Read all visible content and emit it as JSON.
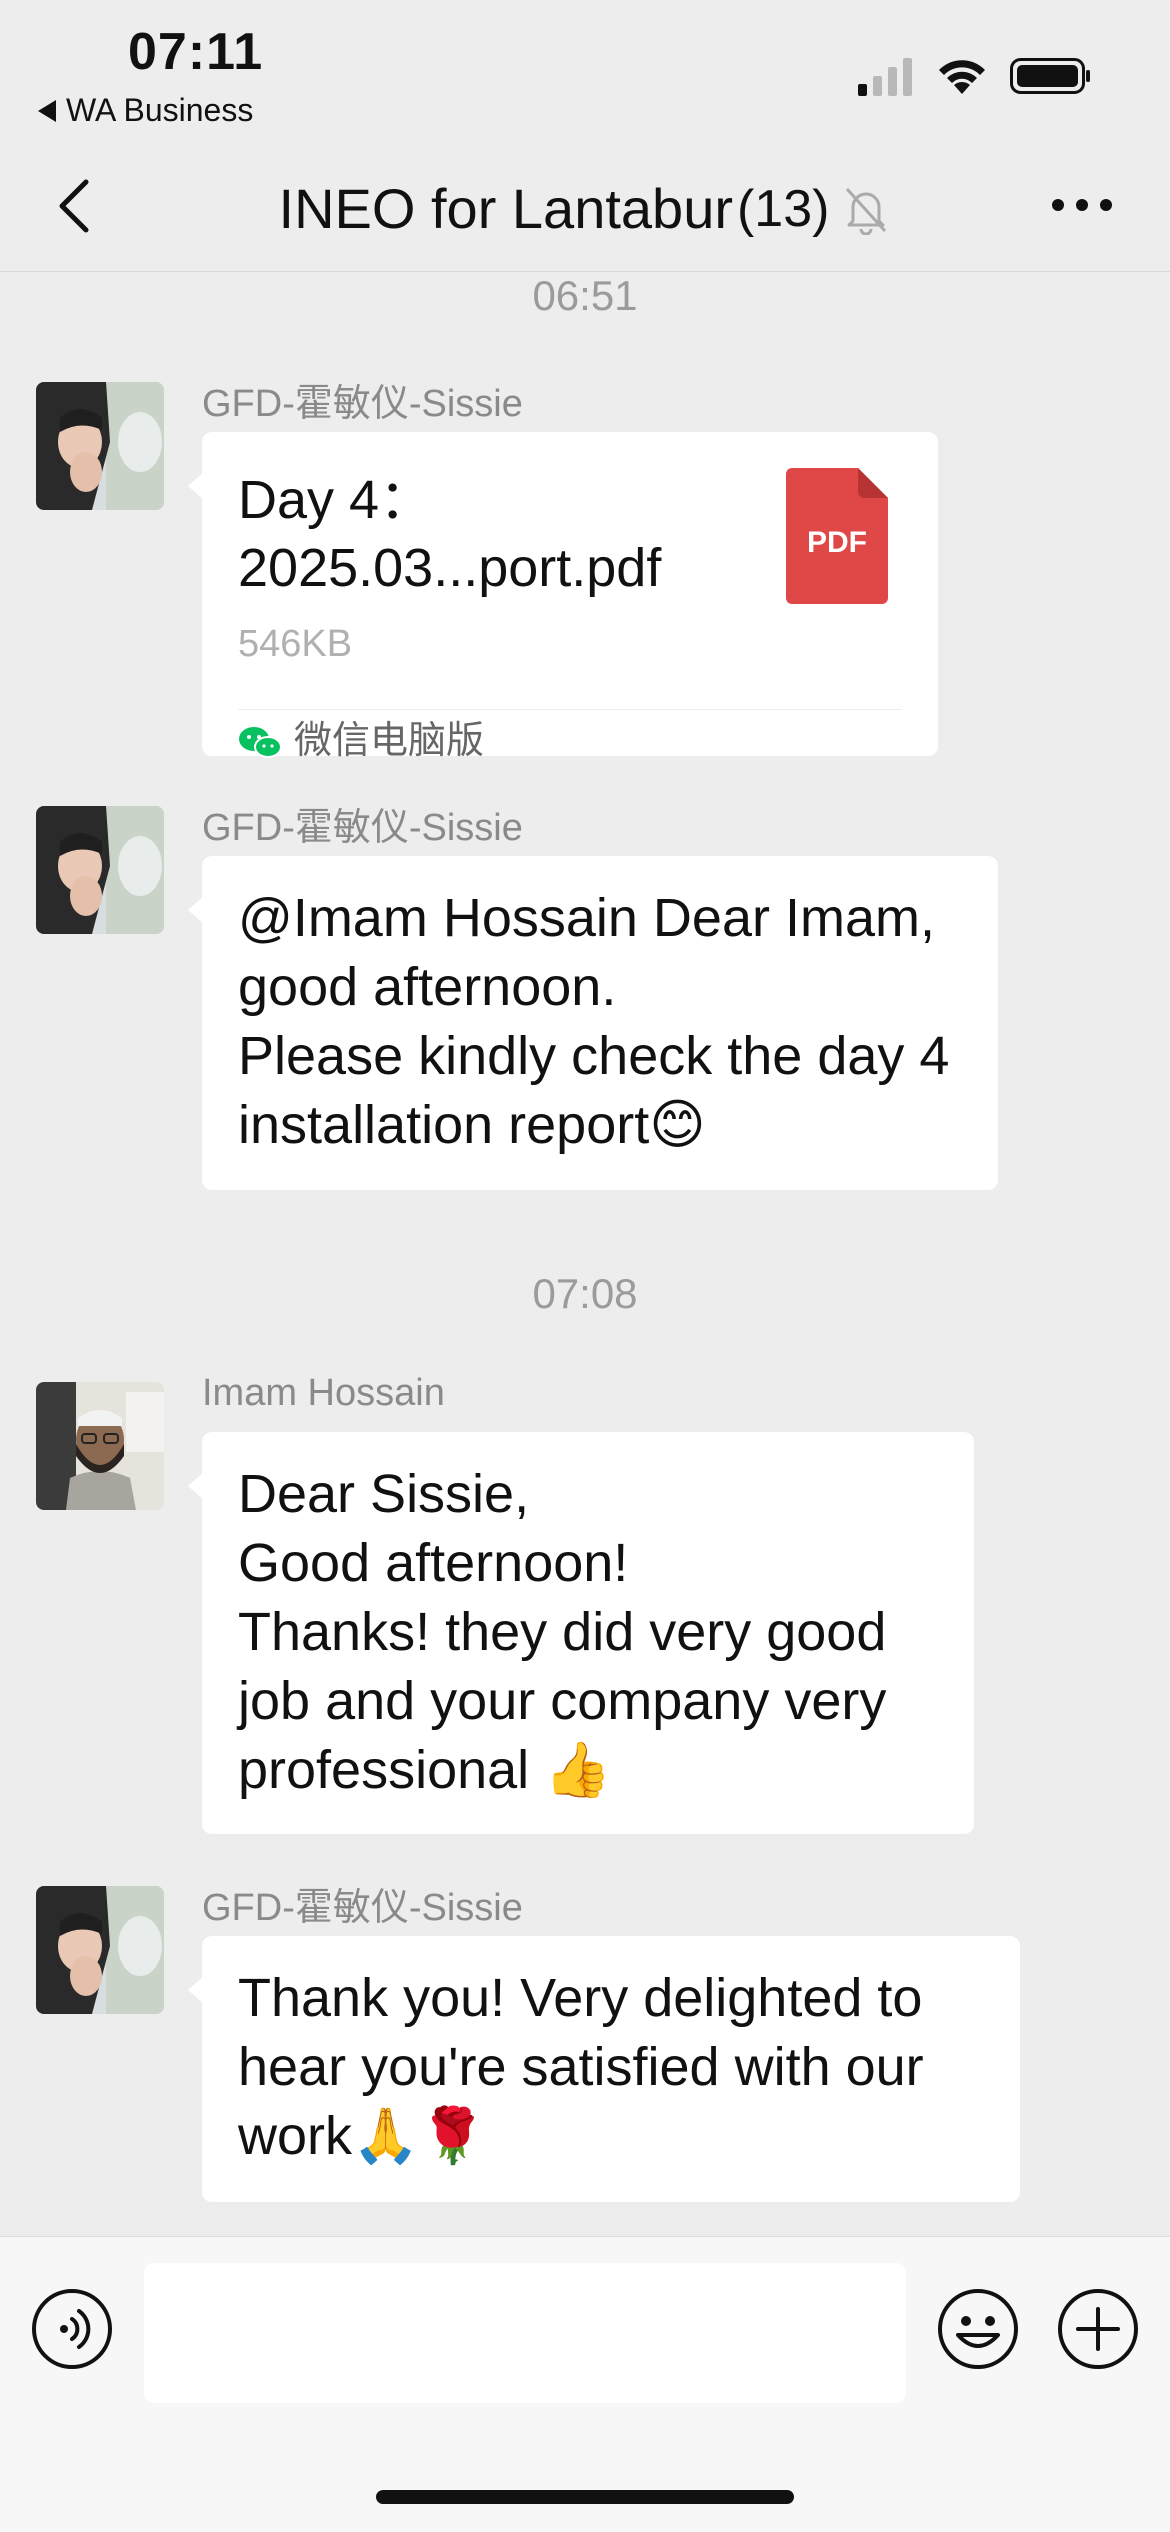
{
  "status_bar": {
    "time": "07:11",
    "back_app": "WA Business"
  },
  "nav": {
    "title": "INEO for Lantabur",
    "member_count": "(13)"
  },
  "messages": [
    {
      "timestamp": "06:51"
    },
    {
      "sender": "GFD-霍敏仪-Sissie",
      "file": {
        "name": "Day 4：2025.03...port.pdf",
        "size": "546KB",
        "icon_label": "PDF",
        "source": "微信电脑版"
      }
    },
    {
      "sender": "GFD-霍敏仪-Sissie",
      "text": "@Imam Hossain Dear Imam, good afternoon.\nPlease kindly check the day 4 installation report😊"
    },
    {
      "timestamp": "07:08"
    },
    {
      "sender": "Imam Hossain",
      "text": "Dear Sissie,\nGood afternoon!\nThanks! they did very good job and your company very professional 👍"
    },
    {
      "sender": "GFD-霍敏仪-Sissie",
      "text": "Thank you! Very delighted to hear you're satisfied with our work🙏🌹"
    }
  ],
  "colors": {
    "background": "#ededed",
    "bubble": "#ffffff",
    "pdf_red": "#e04848",
    "wechat_green": "#07c160"
  },
  "icons": [
    "signal-icon",
    "wifi-icon",
    "battery-icon",
    "back-chevron-icon",
    "mute-bell-icon",
    "more-icon",
    "pdf-icon",
    "wechat-icon",
    "voice-icon",
    "emoji-icon",
    "plus-icon"
  ]
}
